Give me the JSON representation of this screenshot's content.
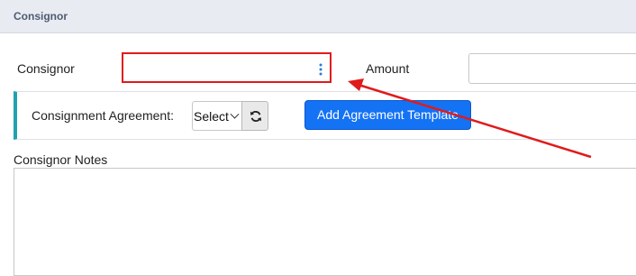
{
  "panel": {
    "title": "Consignor"
  },
  "consignor": {
    "label": "Consignor",
    "value": ""
  },
  "amount": {
    "label": "Amount",
    "value": ""
  },
  "agreement": {
    "label": "Consignment Agreement:",
    "select_value": "Select",
    "refresh_icon": "refresh-icon",
    "add_button_label": "Add Agreement Template"
  },
  "notes": {
    "label": "Consignor Notes",
    "value": ""
  },
  "colors": {
    "header_bg": "#e8ebf1",
    "highlight_red": "#e01b1b",
    "accent_teal": "#23a0b0",
    "button_blue": "#1472f5"
  }
}
